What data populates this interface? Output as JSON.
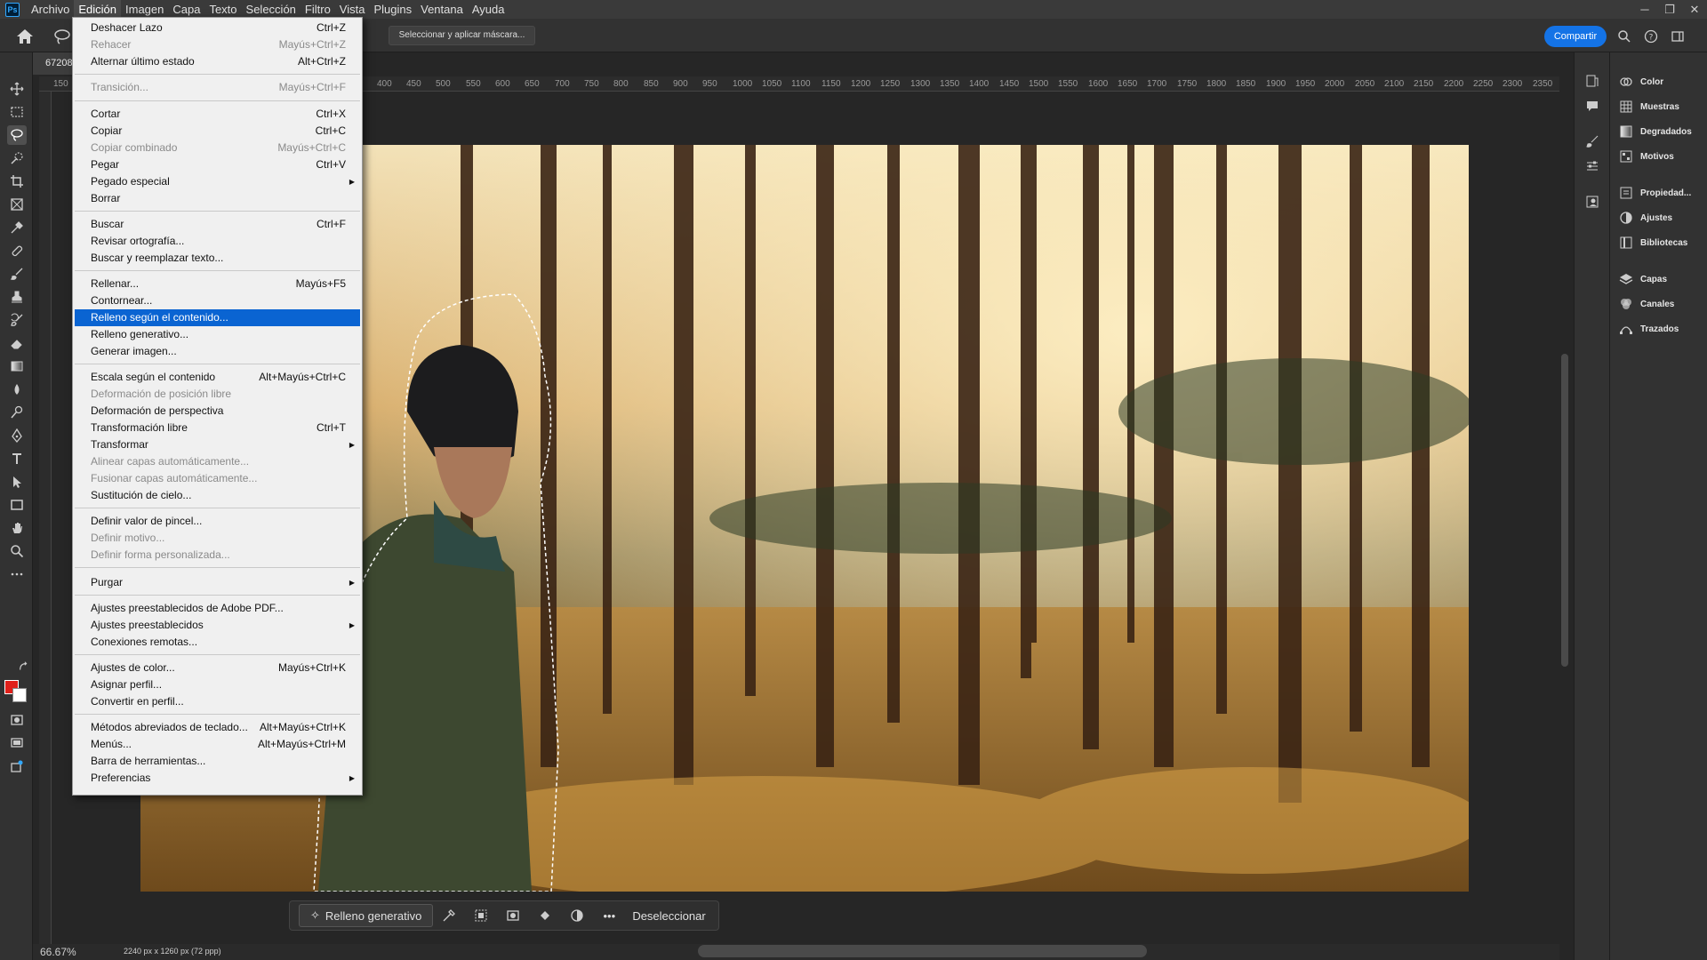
{
  "app": {
    "logo_text": "Ps"
  },
  "menubar": {
    "items": [
      "Archivo",
      "Edición",
      "Imagen",
      "Capa",
      "Texto",
      "Selección",
      "Filtro",
      "Vista",
      "Plugins",
      "Ventana",
      "Ayuda"
    ],
    "active": "Edición"
  },
  "options_bar": {
    "mask_button": "Seleccionar y aplicar máscara...",
    "share_button": "Compartir"
  },
  "document": {
    "tab_label": "67208",
    "zoom": "66.67%",
    "doc_size": "2240 px x 1260 px (72 ppp)"
  },
  "ruler": {
    "ticks": [
      "150",
      "400",
      "450",
      "500",
      "550",
      "600",
      "650",
      "700",
      "750",
      "800",
      "850",
      "900",
      "950",
      "1000",
      "1050",
      "1100",
      "1150",
      "1200",
      "1250",
      "1300",
      "1350",
      "1400",
      "1450",
      "1500",
      "1550",
      "1600",
      "1650",
      "1700",
      "1750",
      "1800",
      "1850",
      "1900",
      "1950",
      "2000",
      "2050",
      "2100",
      "2150",
      "2200",
      "2250",
      "2300",
      "2350"
    ]
  },
  "edit_menu": {
    "items": [
      {
        "label": "Deshacer Lazo",
        "shortcut": "Ctrl+Z"
      },
      {
        "label": "Rehacer",
        "shortcut": "Mayús+Ctrl+Z",
        "disabled": true
      },
      {
        "label": "Alternar último estado",
        "shortcut": "Alt+Ctrl+Z"
      },
      {
        "label": "Transición...",
        "shortcut": "Mayús+Ctrl+F",
        "disabled": true
      },
      {
        "label": "Cortar",
        "shortcut": "Ctrl+X"
      },
      {
        "label": "Copiar",
        "shortcut": "Ctrl+C"
      },
      {
        "label": "Copiar combinado",
        "shortcut": "Mayús+Ctrl+C",
        "disabled": true
      },
      {
        "label": "Pegar",
        "shortcut": "Ctrl+V"
      },
      {
        "label": "Pegado especial",
        "shortcut": ""
      },
      {
        "label": "Borrar",
        "shortcut": ""
      },
      {
        "label": "Buscar",
        "shortcut": "Ctrl+F"
      },
      {
        "label": "Revisar ortografía...",
        "shortcut": ""
      },
      {
        "label": "Buscar y reemplazar texto...",
        "shortcut": ""
      },
      {
        "label": "Rellenar...",
        "shortcut": "Mayús+F5"
      },
      {
        "label": "Contornear...",
        "shortcut": ""
      },
      {
        "label": "Relleno según el contenido...",
        "shortcut": "",
        "highlighted": true
      },
      {
        "label": "Relleno generativo...",
        "shortcut": ""
      },
      {
        "label": "Generar imagen...",
        "shortcut": ""
      },
      {
        "label": "Escala según el contenido",
        "shortcut": "Alt+Mayús+Ctrl+C"
      },
      {
        "label": "Deformación de posición libre",
        "shortcut": "",
        "disabled": true
      },
      {
        "label": "Deformación de perspectiva",
        "shortcut": ""
      },
      {
        "label": "Transformación libre",
        "shortcut": "Ctrl+T"
      },
      {
        "label": "Transformar",
        "shortcut": ""
      },
      {
        "label": "Alinear capas automáticamente...",
        "shortcut": "",
        "disabled": true
      },
      {
        "label": "Fusionar capas automáticamente...",
        "shortcut": "",
        "disabled": true
      },
      {
        "label": "Sustitución de cielo...",
        "shortcut": ""
      },
      {
        "label": "Definir valor de pincel...",
        "shortcut": ""
      },
      {
        "label": "Definir motivo...",
        "shortcut": "",
        "disabled": true
      },
      {
        "label": "Definir forma personalizada...",
        "shortcut": "",
        "disabled": true
      },
      {
        "label": "Purgar",
        "shortcut": ""
      },
      {
        "label": "Ajustes preestablecidos de Adobe PDF...",
        "shortcut": ""
      },
      {
        "label": "Ajustes preestablecidos",
        "shortcut": ""
      },
      {
        "label": "Conexiones remotas...",
        "shortcut": ""
      },
      {
        "label": "Ajustes de color...",
        "shortcut": "Mayús+Ctrl+K"
      },
      {
        "label": "Asignar perfil...",
        "shortcut": ""
      },
      {
        "label": "Convertir en perfil...",
        "shortcut": ""
      },
      {
        "label": "Métodos abreviados de teclado...",
        "shortcut": "Alt+Mayús+Ctrl+K"
      },
      {
        "label": "Menús...",
        "shortcut": "Alt+Mayús+Ctrl+M"
      },
      {
        "label": "Barra de herramientas...",
        "shortcut": ""
      },
      {
        "label": "Preferencias",
        "shortcut": ""
      }
    ]
  },
  "task_bar": {
    "generative_fill": "Relleno generativo",
    "deselect": "Deseleccionar"
  },
  "right_panel": {
    "items": [
      "Color",
      "Muestras",
      "Degradados",
      "Motivos",
      "Propiedad...",
      "Ajustes",
      "Bibliotecas",
      "Capas",
      "Canales",
      "Trazados"
    ]
  },
  "colors": {
    "foreground": "#e0201a",
    "background": "#ffffff",
    "highlight": "#0a64d2",
    "share": "#1473e6"
  }
}
